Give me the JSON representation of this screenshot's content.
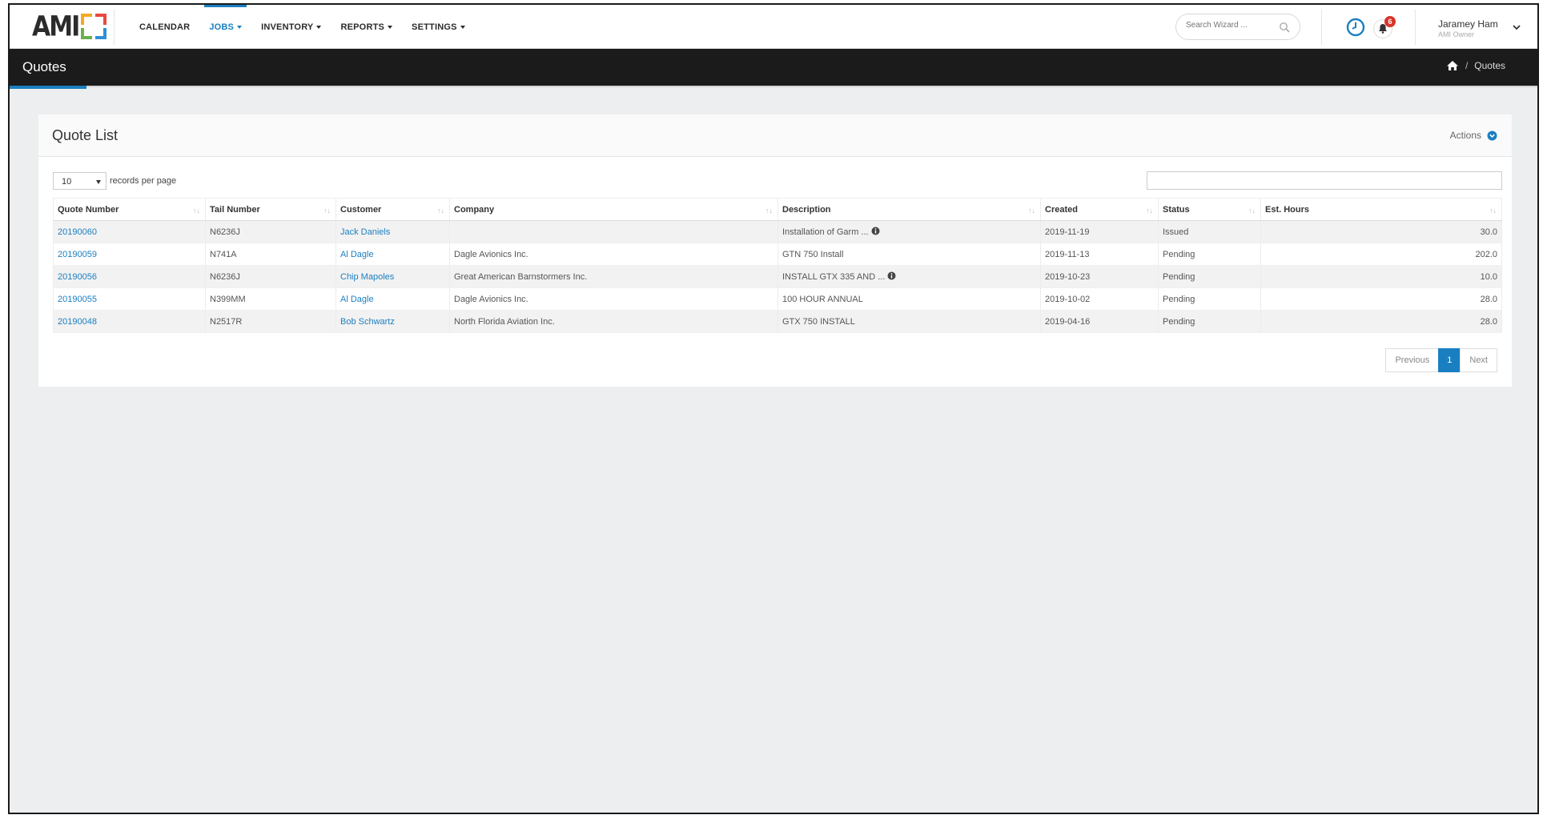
{
  "app": {
    "logo_text": "AMI",
    "colors": {
      "accent": "#1a7fc1",
      "titlebar": "#1b1b1b",
      "badge": "#d9342b"
    }
  },
  "nav": {
    "items": [
      {
        "label": "CALENDAR",
        "has_caret": false,
        "active": false
      },
      {
        "label": "JOBS",
        "has_caret": true,
        "active": true
      },
      {
        "label": "INVENTORY",
        "has_caret": true,
        "active": false
      },
      {
        "label": "REPORTS",
        "has_caret": true,
        "active": false
      },
      {
        "label": "SETTINGS",
        "has_caret": true,
        "active": false
      }
    ],
    "search_placeholder": "Search Wizard ...",
    "notification_count": "6",
    "user_name": "Jaramey Ham",
    "user_role": "AMI Owner"
  },
  "titlebar": {
    "title": "Quotes",
    "breadcrumb_sep": "/",
    "breadcrumb_current": "Quotes"
  },
  "panel": {
    "title": "Quote List",
    "actions_label": "Actions",
    "rpp_value": "10",
    "rpp_label": "records per page"
  },
  "table": {
    "columns": [
      "Quote Number",
      "Tail Number",
      "Customer",
      "Company",
      "Description",
      "Created",
      "Status",
      "Est. Hours"
    ],
    "rows": [
      {
        "quote_number": "20190060",
        "tail_number": "N6236J",
        "customer": "Jack Daniels",
        "company": "",
        "description": "Installation of Garm ...",
        "has_info": true,
        "created": "2019-11-19",
        "status": "Issued",
        "est_hours": "30.0"
      },
      {
        "quote_number": "20190059",
        "tail_number": "N741A",
        "customer": "Al Dagle",
        "company": "Dagle Avionics Inc.",
        "description": "GTN 750 Install",
        "has_info": false,
        "created": "2019-11-13",
        "status": "Pending",
        "est_hours": "202.0"
      },
      {
        "quote_number": "20190056",
        "tail_number": "N6236J",
        "customer": "Chip Mapoles",
        "company": "Great American Barnstormers Inc.",
        "description": "INSTALL GTX 335 AND ...",
        "has_info": true,
        "created": "2019-10-23",
        "status": "Pending",
        "est_hours": "10.0"
      },
      {
        "quote_number": "20190055",
        "tail_number": "N399MM",
        "customer": "Al Dagle",
        "company": "Dagle Avionics Inc.",
        "description": "100 HOUR ANNUAL",
        "has_info": false,
        "created": "2019-10-02",
        "status": "Pending",
        "est_hours": "28.0"
      },
      {
        "quote_number": "20190048",
        "tail_number": "N2517R",
        "customer": "Bob Schwartz",
        "company": "North Florida Aviation Inc.",
        "description": "GTX 750 INSTALL",
        "has_info": false,
        "created": "2019-04-16",
        "status": "Pending",
        "est_hours": "28.0"
      }
    ]
  },
  "pager": {
    "previous": "Previous",
    "current": "1",
    "next": "Next"
  }
}
